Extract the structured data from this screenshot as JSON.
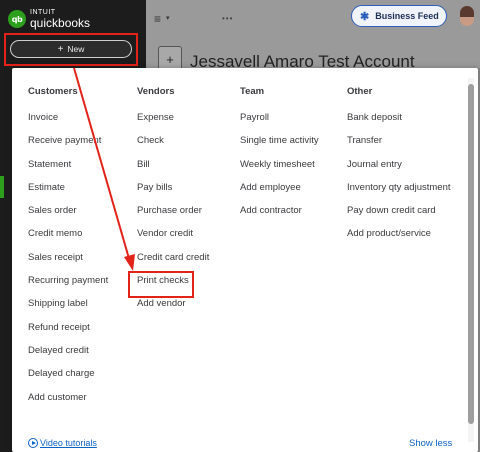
{
  "brand": {
    "logo_mark": "qb",
    "logo_line1": "INTUIT",
    "logo_line2": "quickbooks"
  },
  "sidebar": {
    "new_button_label": "New",
    "new_button_icon": "plus-icon"
  },
  "header": {
    "menu_icon": "hamburger-icon",
    "business_feed_label": "Business Feed",
    "company_name": "Jessavell Amaro Test Account",
    "add_tile_label": "+"
  },
  "new_menu": {
    "columns": [
      {
        "title": "Customers",
        "items": [
          "Invoice",
          "Receive payment",
          "Statement",
          "Estimate",
          "Sales order",
          "Credit memo",
          "Sales receipt",
          "Recurring payment",
          "Shipping label",
          "Refund receipt",
          "Delayed credit",
          "Delayed charge",
          "Add customer"
        ]
      },
      {
        "title": "Vendors",
        "items": [
          "Expense",
          "Check",
          "Bill",
          "Pay bills",
          "Purchase order",
          "Vendor credit",
          "Credit card credit",
          "Print checks",
          "Add vendor"
        ]
      },
      {
        "title": "Team",
        "items": [
          "Payroll",
          "Single time activity",
          "Weekly timesheet",
          "Add employee",
          "Add contractor"
        ]
      },
      {
        "title": "Other",
        "items": [
          "Bank deposit",
          "Transfer",
          "Journal entry",
          "Inventory qty adjustment",
          "Pay down credit card",
          "Add product/service"
        ]
      }
    ],
    "video_tutorials_label": "Video tutorials",
    "show_less_label": "Show less"
  },
  "annotation": {
    "color": "#e2231a",
    "highlighted_item": "Print checks"
  },
  "colors": {
    "sidebar_bg": "#1c1c1c",
    "brand_green": "#2ca01c",
    "link_blue": "#0d62c4",
    "text_dark": "#393a3d"
  }
}
